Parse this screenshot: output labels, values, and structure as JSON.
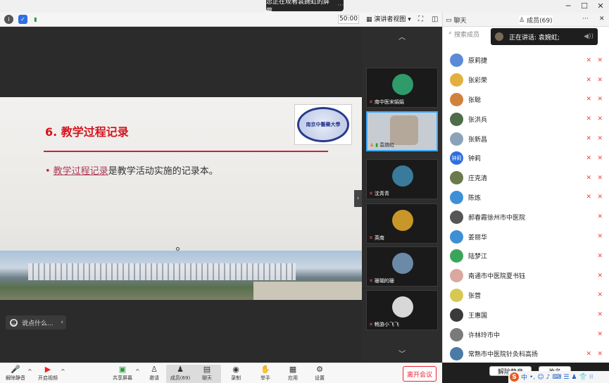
{
  "top": {
    "share_banner": "您正在观看袁婉虹的屏幕",
    "banner_more": "···"
  },
  "window_controls": {
    "minimize": "─",
    "restore": "☐",
    "close": "✕"
  },
  "toolbar": {
    "timer": "50:00",
    "view_label": "演讲者视图",
    "view_caret": "▾"
  },
  "slide": {
    "title": "6. 教学过程记录",
    "bullet_link": "教学过程记录",
    "bullet_rest": "是教学活动实施的记录本。",
    "seal_text": "南京中醫藥大學"
  },
  "chat_input": {
    "placeholder": "说点什么...",
    "chevron": "‹"
  },
  "strip": {
    "up_arrow": "︿",
    "down_arrow": "﹀",
    "collapse": "›",
    "tiles": [
      {
        "name": "南中医宋娟娟"
      },
      {
        "name": "袁婉虹"
      },
      {
        "name": "沈青青"
      },
      {
        "name": "英南"
      },
      {
        "name": "珊瑚的珊"
      },
      {
        "name": "畅游小飞飞"
      }
    ]
  },
  "panel": {
    "chat_tab": "聊天",
    "members_tab": "成员(69)",
    "more": "···",
    "close": "✕",
    "search_placeholder": "搜索成员",
    "speaking_label": "正在讲话: 袁婉虹;",
    "members": [
      {
        "name": "原莉捷",
        "avatar_color": "#5b8bd6"
      },
      {
        "name": "张彩荣",
        "avatar_color": "#e3b040"
      },
      {
        "name": "张聪",
        "avatar_color": "#d0823c"
      },
      {
        "name": "张洪兵",
        "avatar_color": "#4d6c4a"
      },
      {
        "name": "张新昌",
        "avatar_color": "#8aa3b8"
      },
      {
        "name": "钟莉",
        "avatar_color": "#2f6fe0",
        "avatar_text": "钟莉"
      },
      {
        "name": "庄克清",
        "avatar_color": "#6a7a4a"
      },
      {
        "name": "陈炼",
        "avatar_color": "#3d8fd6"
      },
      {
        "name": "郝春霞徐州市中医院",
        "avatar_color": "#555555"
      },
      {
        "name": "姜丽华",
        "avatar_color": "#3d8fd6"
      },
      {
        "name": "陆梦江",
        "avatar_color": "#3aa55a"
      },
      {
        "name": "南通市中医院夏书钰",
        "avatar_color": "#d9a8a0"
      },
      {
        "name": "张营",
        "avatar_color": "#d6c850"
      },
      {
        "name": "王惠国",
        "avatar_color": "#3a3a3a"
      },
      {
        "name": "许林玲市中",
        "avatar_color": "#7a7a7a"
      },
      {
        "name": "常熟市中医院针灸科高扬",
        "avatar_color": "#4a7aa8"
      }
    ],
    "mute_all": "解除静音",
    "rename": "改名"
  },
  "bottom": {
    "unmute": "解除静音",
    "video": "开启视频",
    "share": "共享屏幕",
    "invite": "邀请",
    "members": "成员(69)",
    "chat": "聊天",
    "record": "录制",
    "raise_hand": "举手",
    "apps": "应用",
    "settings": "设置",
    "leave": "离开会议",
    "caret": "^"
  },
  "ime": {
    "logo": "S",
    "lang": "中",
    "items": [
      "•,",
      "☺",
      "♪",
      "⌨",
      "☰",
      "♟",
      "👕",
      "⁝⁝"
    ]
  },
  "colors": {
    "accent_blue": "#3aa9ff",
    "title_red": "#d6121c",
    "leave_red": "#e22233"
  }
}
